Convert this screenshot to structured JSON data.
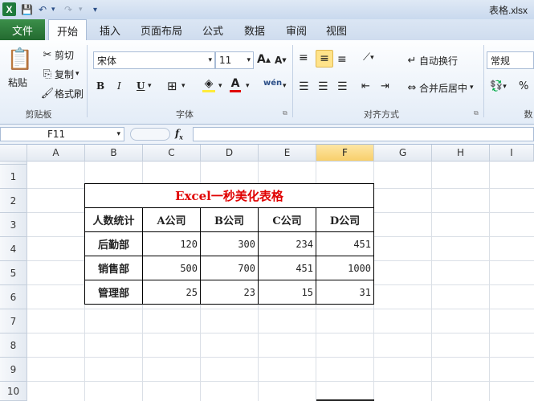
{
  "window": {
    "title": "表格.xlsx"
  },
  "tabs": {
    "file": "文件",
    "items": [
      "开始",
      "插入",
      "页面布局",
      "公式",
      "数据",
      "审阅",
      "视图"
    ],
    "active": "开始"
  },
  "clipboard": {
    "paste": "粘贴",
    "cut": "剪切",
    "copy": "复制",
    "format_painter": "格式刷",
    "group": "剪贴板"
  },
  "font": {
    "name": "宋体",
    "size": "11",
    "bold": "B",
    "italic": "I",
    "underline": "U",
    "group": "字体"
  },
  "alignment": {
    "wrap_text": "自动换行",
    "merge_center": "合并后居中",
    "group": "对齐方式"
  },
  "number": {
    "format": "常规",
    "group": "数",
    "percent": "%"
  },
  "formula_bar": {
    "name_box": "F11",
    "fx": "fx",
    "content": ""
  },
  "columns": [
    "A",
    "B",
    "C",
    "D",
    "E",
    "F",
    "G",
    "H",
    "I"
  ],
  "selected_column": "F",
  "rows": [
    "1",
    "2",
    "3",
    "4",
    "5",
    "6",
    "7",
    "8",
    "9",
    "10"
  ],
  "sheet": {
    "title": "Excel一秒美化表格",
    "headers": [
      "人数统计",
      "A公司",
      "B公司",
      "C公司",
      "D公司"
    ],
    "data": [
      [
        "后勤部",
        "120",
        "300",
        "234",
        "451"
      ],
      [
        "销售部",
        "500",
        "700",
        "451",
        "1000"
      ],
      [
        "管理部",
        "25",
        "23",
        "15",
        "31"
      ]
    ]
  },
  "colors": {
    "title_red": "#e00000",
    "file_tab_green": "#236a30",
    "selected_col": "#f8cf6b"
  }
}
